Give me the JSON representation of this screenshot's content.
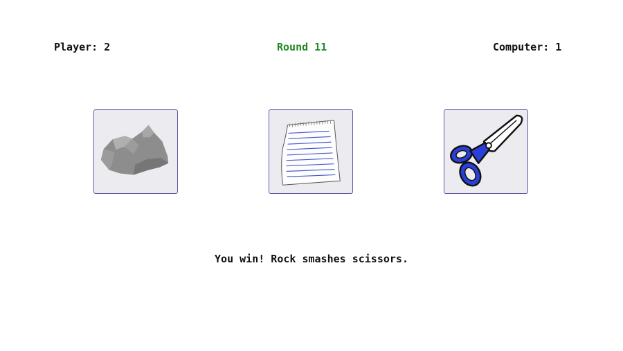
{
  "scoreboard": {
    "player": "Player: 2",
    "round": "Round 11",
    "computer": "Computer: 1"
  },
  "choices": [
    {
      "id": "rock",
      "icon": "rock-icon"
    },
    {
      "id": "paper",
      "icon": "paper-icon"
    },
    {
      "id": "scissors",
      "icon": "scissors-icon"
    }
  ],
  "result": "You win! Rock smashes scissors.",
  "colors": {
    "round_text": "#1f8a1f",
    "tile_background": "#ebebf0",
    "tile_border": "#5a5aa6",
    "scissors_handle": "#2a3fd6"
  }
}
